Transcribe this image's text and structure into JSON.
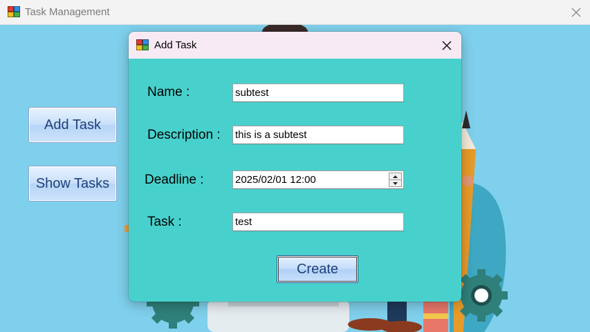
{
  "window": {
    "title": "Task Management",
    "close_icon": "close-icon"
  },
  "sidebar": {
    "add_task_label": "Add Task",
    "show_tasks_label": "Show Tasks"
  },
  "dialog": {
    "title": "Add Task",
    "fields": {
      "name": {
        "label": "Name :",
        "value": "subtest"
      },
      "description": {
        "label": "Description :",
        "value": "this is a subtest"
      },
      "deadline": {
        "label": "Deadline :",
        "value": "2025/02/01 12:00"
      },
      "task": {
        "label": "Task :",
        "value": "test"
      }
    },
    "create_label": "Create"
  },
  "colors": {
    "client_bg": "#7fd0ec",
    "dialog_bg": "#48d1cc",
    "dialog_titlebar": "#f8eaf4",
    "button_text": "#1f3f7a"
  }
}
